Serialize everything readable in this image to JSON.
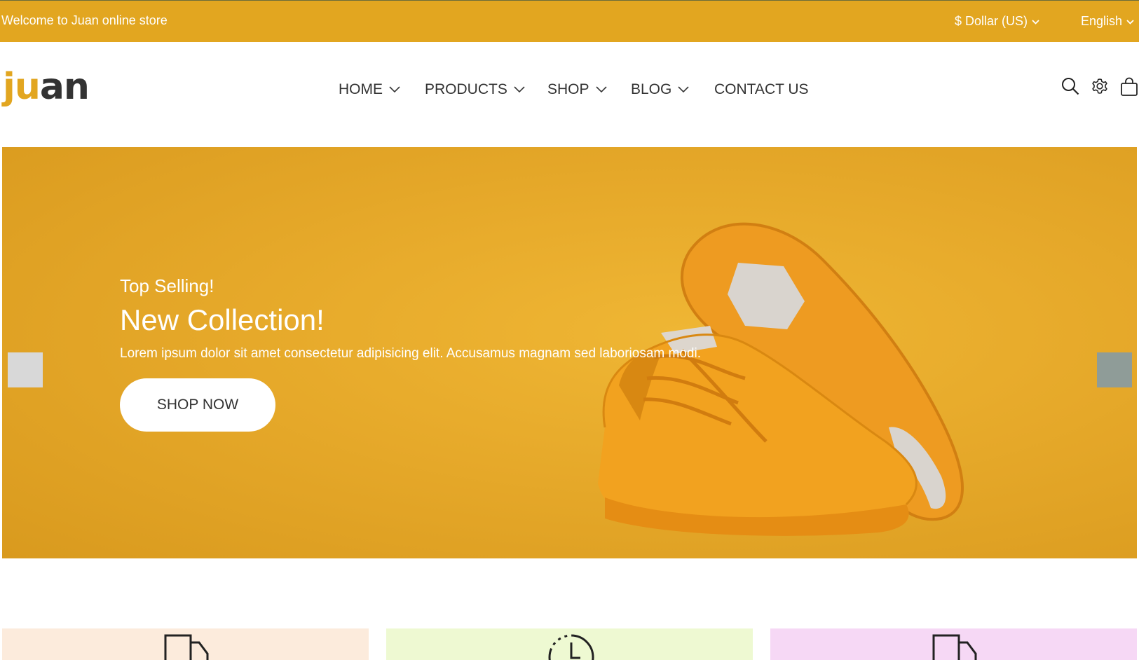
{
  "topbar": {
    "welcome": "Welcome to Juan online store",
    "currency": "$ Dollar (US)",
    "language": "English",
    "background_color": "#e2a620"
  },
  "header": {
    "logo_part1": "ju",
    "logo_part2": "an",
    "nav": [
      {
        "label": "HOME",
        "has_dropdown": true
      },
      {
        "label": "PRODUCTS",
        "has_dropdown": true
      },
      {
        "label": "SHOP",
        "has_dropdown": true
      },
      {
        "label": "BLOG",
        "has_dropdown": true
      },
      {
        "label": "CONTACT US",
        "has_dropdown": false
      }
    ],
    "icons": [
      "search-icon",
      "gear-icon",
      "shopping-bag-icon"
    ]
  },
  "hero": {
    "subtitle": "Top Selling!",
    "title": "New Collection!",
    "description": "Lorem ipsum dolor sit amet consectetur adipisicing elit. Accusamus magnam sed laboriosam modi.",
    "button_label": "SHOP NOW",
    "background_color": "#e6a92a"
  },
  "features": [
    {
      "icon": "truck-icon",
      "color": "#fcebdc"
    },
    {
      "icon": "clock-icon",
      "color": "#eef9d2"
    },
    {
      "icon": "truck-icon",
      "color": "#f6d8f5"
    }
  ]
}
